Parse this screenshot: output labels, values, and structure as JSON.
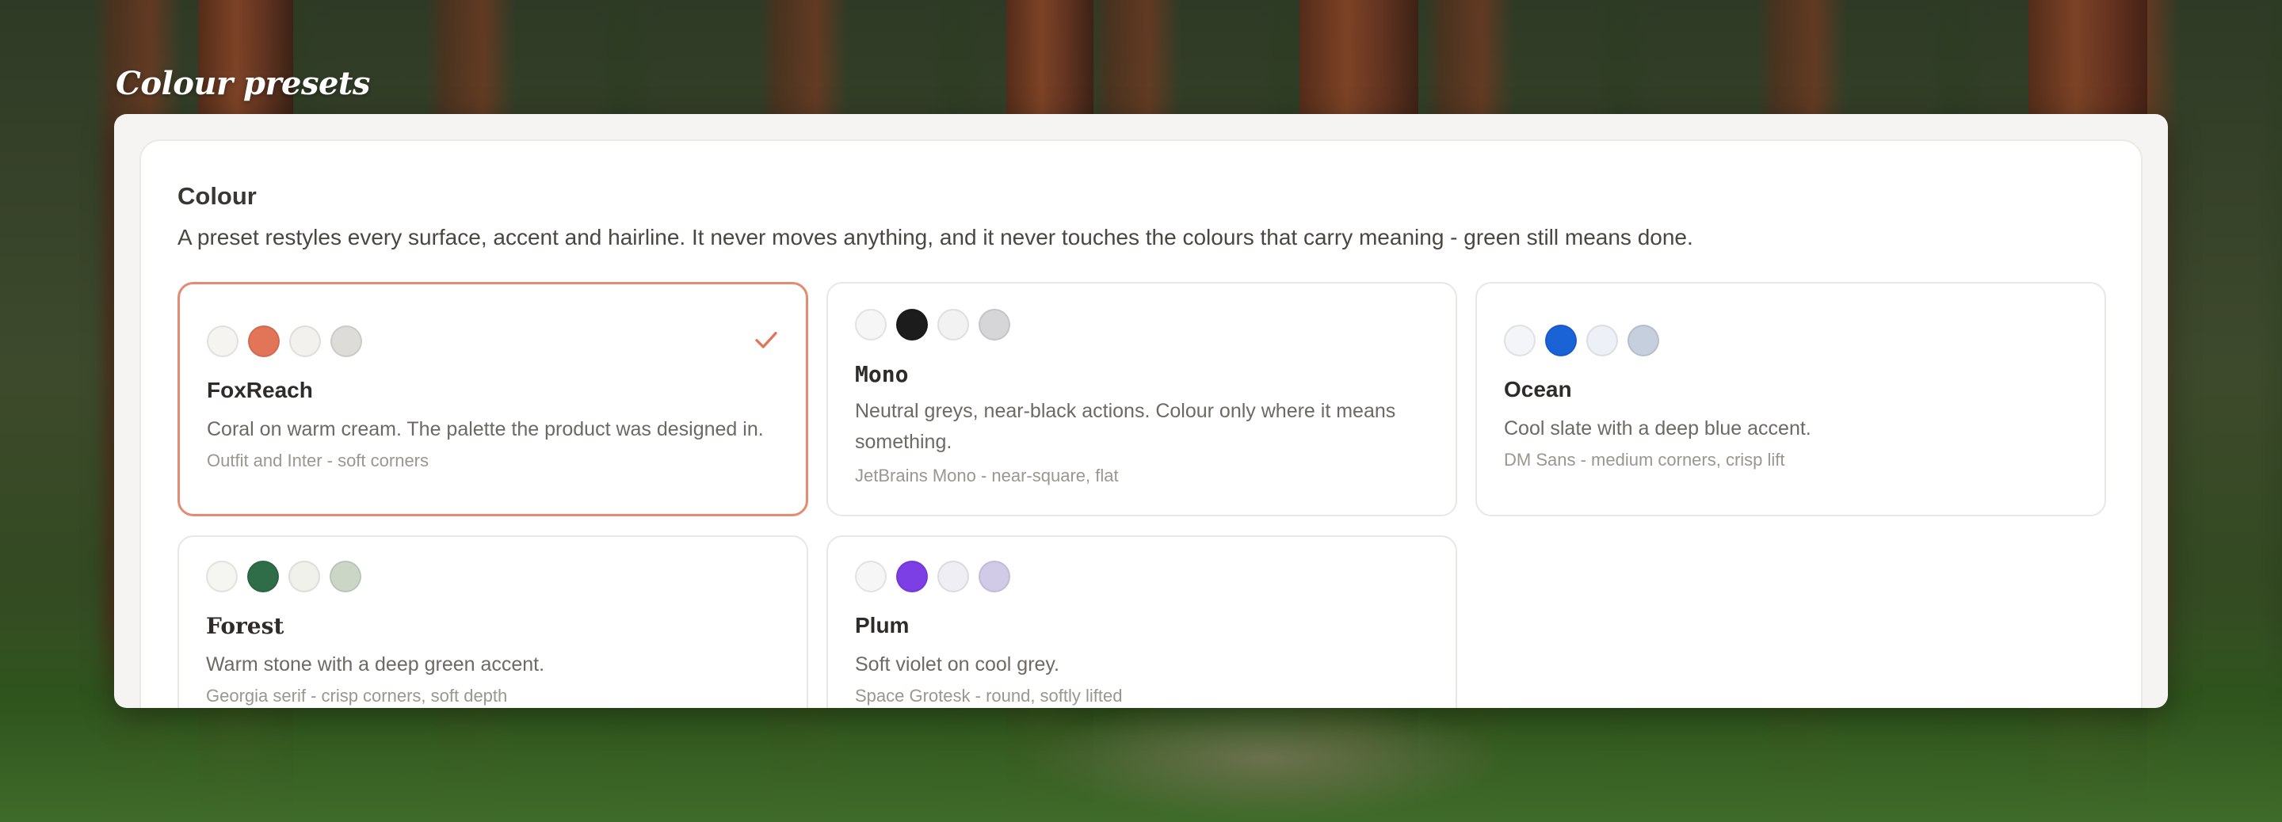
{
  "page": {
    "heading": "Colour presets"
  },
  "section": {
    "title": "Colour",
    "description": "A preset restyles every surface, accent and hairline. It never moves anything, and it never touches the colours that carry meaning - green still means done."
  },
  "presets": [
    {
      "name": "FoxReach",
      "description": "Coral on warm cream. The palette the product was designed in.",
      "meta": "Outfit and Inter - soft corners",
      "selected": true,
      "swatches": [
        "#f6f4f1",
        "#e27458",
        "#f3f1ee",
        "#dedcd8"
      ]
    },
    {
      "name": "Mono",
      "description": "Neutral greys, near-black actions. Colour only where it means something.",
      "meta": "JetBrains Mono - near-square, flat",
      "selected": false,
      "swatches": [
        "#f6f6f6",
        "#1c1c1c",
        "#f2f2f3",
        "#d6d6d9"
      ]
    },
    {
      "name": "Ocean",
      "description": "Cool slate with a deep blue accent.",
      "meta": "DM Sans - medium corners, crisp lift",
      "selected": false,
      "swatches": [
        "#f3f5f8",
        "#1a63d6",
        "#edf1f7",
        "#c6cfdd"
      ]
    },
    {
      "name": "Forest",
      "description": "Warm stone with a deep green accent.",
      "meta": "Georgia serif - crisp corners, soft depth",
      "selected": false,
      "swatches": [
        "#f5f5f1",
        "#2f6d48",
        "#eff1ea",
        "#cbd6c6"
      ]
    },
    {
      "name": "Plum",
      "description": "Soft violet on cool grey.",
      "meta": "Space Grotesk - round, softly lifted",
      "selected": false,
      "swatches": [
        "#f6f6f7",
        "#7c3fe6",
        "#eeeef4",
        "#d2cbe8"
      ]
    }
  ],
  "icons": {
    "selected_check": "check-icon"
  },
  "colors": {
    "accent": "#e58a73",
    "check": "#e27458"
  }
}
